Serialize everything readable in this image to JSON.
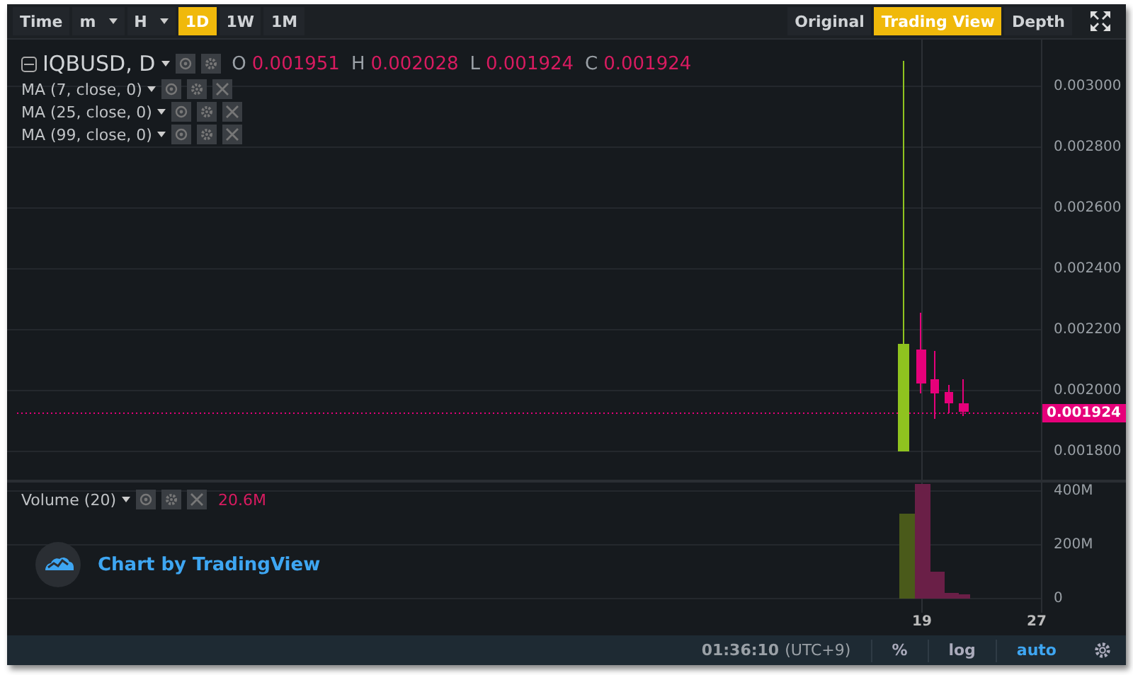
{
  "toolbar": {
    "intervals": [
      {
        "label": "Time",
        "selected": false,
        "dropdown": false
      },
      {
        "label": "m",
        "selected": false,
        "dropdown": true
      },
      {
        "label": "H",
        "selected": false,
        "dropdown": true
      },
      {
        "label": "1D",
        "selected": true,
        "dropdown": false
      },
      {
        "label": "1W",
        "selected": false,
        "dropdown": false
      },
      {
        "label": "1M",
        "selected": false,
        "dropdown": false
      }
    ],
    "views": [
      {
        "label": "Original",
        "selected": false
      },
      {
        "label": "Trading View",
        "selected": true
      },
      {
        "label": "Depth",
        "selected": false
      }
    ]
  },
  "legend": {
    "symbol": "IQBUSD, D",
    "ohlc": [
      {
        "label": "O",
        "value": "0.001951"
      },
      {
        "label": "H",
        "value": "0.002028"
      },
      {
        "label": "L",
        "value": "0.001924"
      },
      {
        "label": "C",
        "value": "0.001924"
      }
    ]
  },
  "indicators": [
    {
      "name": "MA (7, close, 0)"
    },
    {
      "name": "MA (25, close, 0)"
    },
    {
      "name": "MA (99, close, 0)"
    }
  ],
  "price_axis": [
    "0.003000",
    "0.002800",
    "0.002600",
    "0.002400",
    "0.002200",
    "0.002000",
    "0.001800"
  ],
  "current_price": "0.001924",
  "volume": {
    "name": "Volume (20)",
    "value": "20.6M",
    "axis": [
      "400M",
      "200M",
      "0"
    ]
  },
  "branding": "Chart by TradingView",
  "time_axis": [
    "19",
    "27"
  ],
  "status_bar": {
    "time": "01:36:10",
    "timezone": "(UTC+9)",
    "buttons": [
      {
        "label": "%",
        "selected": false
      },
      {
        "label": "log",
        "selected": false
      },
      {
        "label": "auto",
        "selected": true
      }
    ]
  }
}
